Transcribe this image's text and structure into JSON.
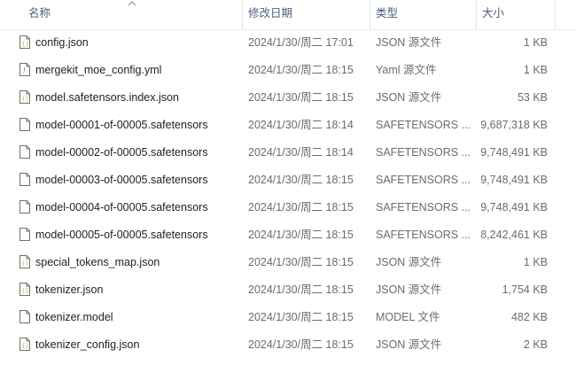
{
  "columns": {
    "name": "名称",
    "date": "修改日期",
    "type": "类型",
    "size": "大小"
  },
  "files": [
    {
      "name": "config.json",
      "date": "2024/1/30/周二 17:01",
      "type": "JSON 源文件",
      "size": "1 KB",
      "icon": "json-file-icon"
    },
    {
      "name": "mergekit_moe_config.yml",
      "date": "2024/1/30/周二 18:15",
      "type": "Yaml 源文件",
      "size": "1 KB",
      "icon": "yaml-file-icon"
    },
    {
      "name": "model.safetensors.index.json",
      "date": "2024/1/30/周二 18:15",
      "type": "JSON 源文件",
      "size": "53 KB",
      "icon": "json-file-icon"
    },
    {
      "name": "model-00001-of-00005.safetensors",
      "date": "2024/1/30/周二 18:14",
      "type": "SAFETENSORS ...",
      "size": "9,687,318 KB",
      "icon": "file-icon"
    },
    {
      "name": "model-00002-of-00005.safetensors",
      "date": "2024/1/30/周二 18:14",
      "type": "SAFETENSORS ...",
      "size": "9,748,491 KB",
      "icon": "file-icon"
    },
    {
      "name": "model-00003-of-00005.safetensors",
      "date": "2024/1/30/周二 18:15",
      "type": "SAFETENSORS ...",
      "size": "9,748,491 KB",
      "icon": "file-icon"
    },
    {
      "name": "model-00004-of-00005.safetensors",
      "date": "2024/1/30/周二 18:15",
      "type": "SAFETENSORS ...",
      "size": "9,748,491 KB",
      "icon": "file-icon"
    },
    {
      "name": "model-00005-of-00005.safetensors",
      "date": "2024/1/30/周二 18:15",
      "type": "SAFETENSORS ...",
      "size": "8,242,461 KB",
      "icon": "file-icon"
    },
    {
      "name": "special_tokens_map.json",
      "date": "2024/1/30/周二 18:15",
      "type": "JSON 源文件",
      "size": "1 KB",
      "icon": "json-file-icon"
    },
    {
      "name": "tokenizer.json",
      "date": "2024/1/30/周二 18:15",
      "type": "JSON 源文件",
      "size": "1,754 KB",
      "icon": "json-file-icon"
    },
    {
      "name": "tokenizer.model",
      "date": "2024/1/30/周二 18:15",
      "type": "MODEL 文件",
      "size": "482 KB",
      "icon": "file-icon"
    },
    {
      "name": "tokenizer_config.json",
      "date": "2024/1/30/周二 18:15",
      "type": "JSON 源文件",
      "size": "2 KB",
      "icon": "json-file-icon"
    }
  ],
  "colors": {
    "header_text": "#4c607a",
    "json_icon_accent": "#e3b23c",
    "yaml_icon_accent": "#3f6fd1"
  }
}
